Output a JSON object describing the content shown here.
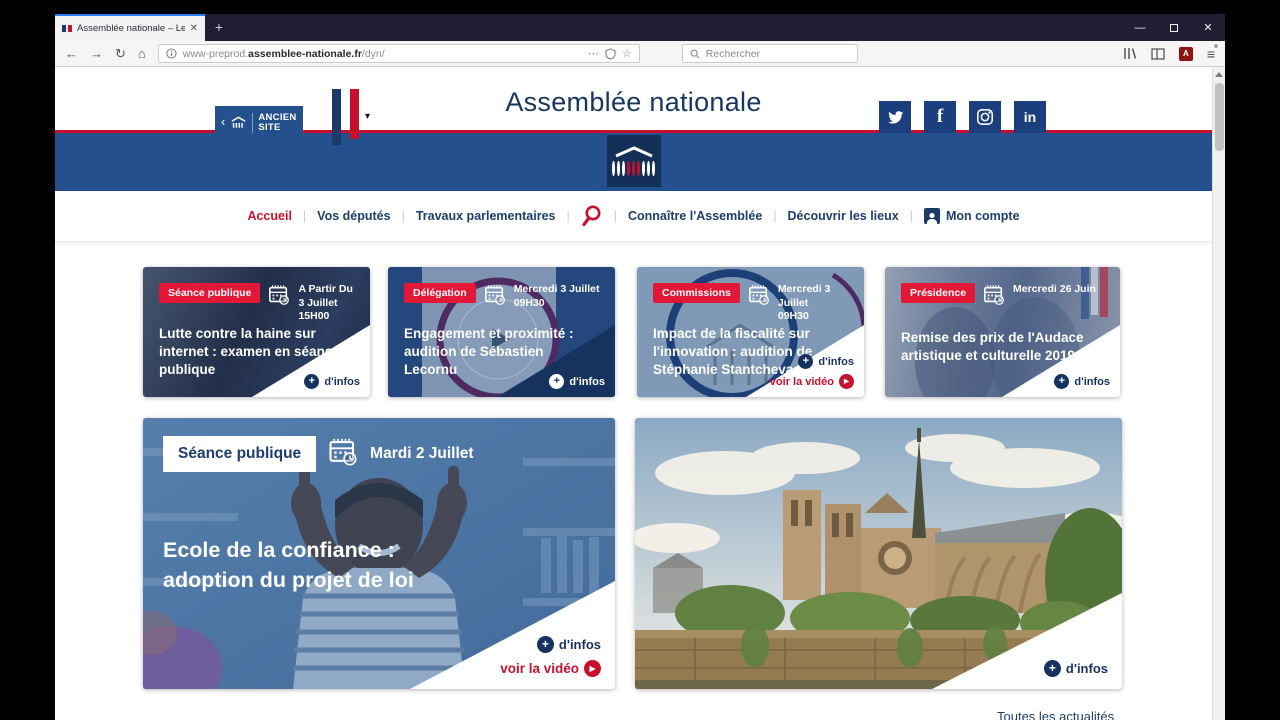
{
  "browser": {
    "tab_title": "Assemblée nationale – Les dép",
    "new_tab": "+",
    "url_prefix": "www-preprod.",
    "url_domain": "assemblee-nationale.fr",
    "url_path": "/dyn/",
    "search_placeholder": "Rechercher"
  },
  "header": {
    "ancien_site_line1": "ANCIEN",
    "ancien_site_line2": "SITE",
    "title": "Assemblée nationale",
    "social": [
      "twitter",
      "facebook",
      "instagram",
      "linkedin"
    ]
  },
  "nav": {
    "items": [
      {
        "label": "Accueil",
        "active": true
      },
      {
        "label": "Vos députés"
      },
      {
        "label": "Travaux parlementaires"
      },
      {
        "label": "Connaître l'Assemblée"
      },
      {
        "label": "Découvrir les lieux"
      },
      {
        "label": "Mon compte"
      }
    ]
  },
  "cards": [
    {
      "badge": "Séance publique",
      "date_line1": "A Partir Du 3 Juillet",
      "date_line2": "15H00",
      "title": "Lutte contre la haine sur internet : examen en séance publique",
      "more": "d'infos"
    },
    {
      "badge": "Délégation",
      "date_line1": "Mercredi 3 Juillet",
      "date_line2": "09H30",
      "title": "Engagement et proximité : audition de Sébastien Lecornu",
      "more": "d'infos"
    },
    {
      "badge": "Commissions",
      "date_line1": "Mercredi 3 Juillet",
      "date_line2": "09H30",
      "title": "Impact de la fiscalité sur l'innovation : audition de Stéphanie Stantcheva",
      "more": "d'infos",
      "video": "voir la vidéo"
    },
    {
      "badge": "Présidence",
      "date_line1": "Mercredi 26 Juin",
      "date_line2": "",
      "title": "Remise des prix de l'Audace artistique et culturelle 2019",
      "more": "d'infos"
    }
  ],
  "featured_left": {
    "badge": "Séance publique",
    "date": "Mardi 2 Juillet",
    "title": "Ecole de la confiance : adoption du projet de loi",
    "more": "d'infos",
    "video": "voir la vidéo"
  },
  "featured_right": {
    "more": "d'infos"
  },
  "footer_link": "Toutes les actualités",
  "colors": {
    "navy_band": "#24518e",
    "dark_navy": "#16335f",
    "accent_red": "#c8102e",
    "badge_red": "#e31837"
  }
}
